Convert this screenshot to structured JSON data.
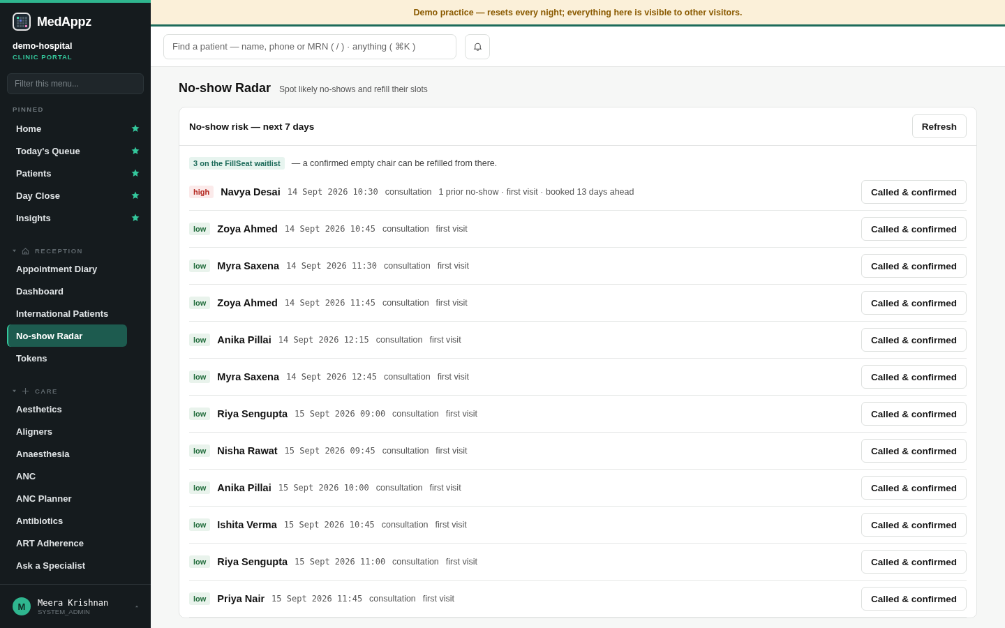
{
  "brand": {
    "name": "MedAppz",
    "org": "demo-hospital",
    "portal": "CLINIC PORTAL"
  },
  "menu_filter": {
    "placeholder": "Filter this menu..."
  },
  "pinned": {
    "label": "PINNED",
    "items": [
      {
        "label": "Home"
      },
      {
        "label": "Today's Queue"
      },
      {
        "label": "Patients"
      },
      {
        "label": "Day Close"
      },
      {
        "label": "Insights"
      }
    ]
  },
  "groups": [
    {
      "label": "RECEPTION",
      "items": [
        {
          "label": "Appointment Diary",
          "selected": false
        },
        {
          "label": "Dashboard",
          "selected": false
        },
        {
          "label": "International Patients",
          "selected": false
        },
        {
          "label": "No-show Radar",
          "selected": true
        },
        {
          "label": "Tokens",
          "selected": false
        }
      ]
    },
    {
      "label": "CARE",
      "items": [
        {
          "label": "Aesthetics",
          "selected": false
        },
        {
          "label": "Aligners",
          "selected": false
        },
        {
          "label": "Anaesthesia",
          "selected": false
        },
        {
          "label": "ANC",
          "selected": false
        },
        {
          "label": "ANC Planner",
          "selected": false
        },
        {
          "label": "Antibiotics",
          "selected": false
        },
        {
          "label": "ART Adherence",
          "selected": false
        },
        {
          "label": "Ask a Specialist",
          "selected": false
        }
      ]
    }
  ],
  "user": {
    "initial": "M",
    "name": "Meera Krishnan",
    "role": "SYSTEM_ADMIN"
  },
  "banner": "Demo practice — resets every night; everything here is visible to other visitors.",
  "search": {
    "placeholder": "Find a patient — name, phone or MRN ( / ) · anything ( ⌘K )"
  },
  "page": {
    "title": "No-show Radar",
    "subtitle": "Spot likely no-shows and refill their slots"
  },
  "card": {
    "title": "No-show risk — next 7 days",
    "refresh": "Refresh",
    "waitlist_badge": "3 on the FillSeat waitlist",
    "waitlist_note": "— a confirmed empty chair can be refilled from there."
  },
  "rows": [
    {
      "risk": "high",
      "name": "Navya Desai",
      "when": "14 Sept 2026 10:30",
      "type": "consultation",
      "notes": "1 prior no-show · first visit · booked 13 days ahead",
      "action": "Called & confirmed"
    },
    {
      "risk": "low",
      "name": "Zoya Ahmed",
      "when": "14 Sept 2026 10:45",
      "type": "consultation",
      "notes": "first visit",
      "action": "Called & confirmed"
    },
    {
      "risk": "low",
      "name": "Myra Saxena",
      "when": "14 Sept 2026 11:30",
      "type": "consultation",
      "notes": "first visit",
      "action": "Called & confirmed"
    },
    {
      "risk": "low",
      "name": "Zoya Ahmed",
      "when": "14 Sept 2026 11:45",
      "type": "consultation",
      "notes": "first visit",
      "action": "Called & confirmed"
    },
    {
      "risk": "low",
      "name": "Anika Pillai",
      "when": "14 Sept 2026 12:15",
      "type": "consultation",
      "notes": "first visit",
      "action": "Called & confirmed"
    },
    {
      "risk": "low",
      "name": "Myra Saxena",
      "when": "14 Sept 2026 12:45",
      "type": "consultation",
      "notes": "first visit",
      "action": "Called & confirmed"
    },
    {
      "risk": "low",
      "name": "Riya Sengupta",
      "when": "15 Sept 2026 09:00",
      "type": "consultation",
      "notes": "first visit",
      "action": "Called & confirmed"
    },
    {
      "risk": "low",
      "name": "Nisha Rawat",
      "when": "15 Sept 2026 09:45",
      "type": "consultation",
      "notes": "first visit",
      "action": "Called & confirmed"
    },
    {
      "risk": "low",
      "name": "Anika Pillai",
      "when": "15 Sept 2026 10:00",
      "type": "consultation",
      "notes": "first visit",
      "action": "Called & confirmed"
    },
    {
      "risk": "low",
      "name": "Ishita Verma",
      "when": "15 Sept 2026 10:45",
      "type": "consultation",
      "notes": "first visit",
      "action": "Called & confirmed"
    },
    {
      "risk": "low",
      "name": "Riya Sengupta",
      "when": "15 Sept 2026 11:00",
      "type": "consultation",
      "notes": "first visit",
      "action": "Called & confirmed"
    },
    {
      "risk": "low",
      "name": "Priya Nair",
      "when": "15 Sept 2026 11:45",
      "type": "consultation",
      "notes": "first visit",
      "action": "Called & confirmed"
    }
  ]
}
